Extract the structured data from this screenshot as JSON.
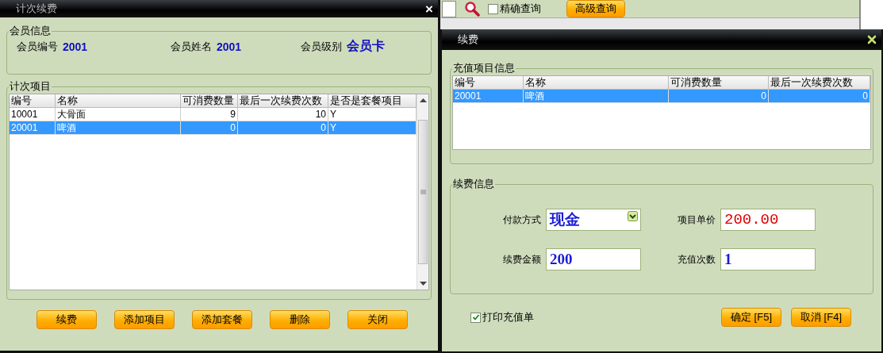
{
  "count_renewal_window": {
    "title": "计次续费",
    "close": "×",
    "member_info": {
      "title": "会员信息",
      "fields": [
        {
          "label": "会员编号",
          "value": "2001"
        },
        {
          "label": "会员姓名",
          "value": "2001"
        },
        {
          "label": "会员级别",
          "value": "会员卡"
        }
      ]
    },
    "count_items": {
      "title": "计次项目",
      "columns": [
        "编号",
        "名称",
        "可消费数量",
        "最后一次续费次数",
        "是否是套餐项目"
      ],
      "rows": [
        {
          "cells": [
            "10001",
            "大骨面",
            "9",
            "10",
            "Y"
          ],
          "selected": false
        },
        {
          "cells": [
            "20001",
            "啤酒",
            "0",
            "0",
            "Y"
          ],
          "selected": true
        }
      ]
    },
    "buttons": [
      "续费",
      "添加项目",
      "添加套餐",
      "删除",
      "关闭"
    ]
  },
  "background_toolbar": {
    "exact_match": {
      "label": "精确查询",
      "checked": false
    },
    "advanced_search": "高级查询"
  },
  "renew_dialog": {
    "title": "续费",
    "recharge_items": {
      "title": "充值项目信息",
      "columns": [
        "编号",
        "名称",
        "可消费数量",
        "最后一次续费次数"
      ],
      "rows": [
        {
          "cells": [
            "20001",
            "啤酒",
            "0",
            "0"
          ],
          "selected": true
        }
      ]
    },
    "renew_info": {
      "title": "续费信息",
      "fields": [
        {
          "label": "付款方式",
          "value": "现金",
          "kind": "select"
        },
        {
          "label": "项目单价",
          "value": "200.00",
          "kind": "price"
        },
        {
          "label": "续费金额",
          "value": "200",
          "kind": "amount"
        },
        {
          "label": "充值次数",
          "value": "1",
          "kind": "amount"
        }
      ]
    },
    "print_receipt": {
      "label": "打印充值单",
      "checked": true
    },
    "buttons": [
      "确定 [F5]",
      "取消 [F4]"
    ]
  }
}
